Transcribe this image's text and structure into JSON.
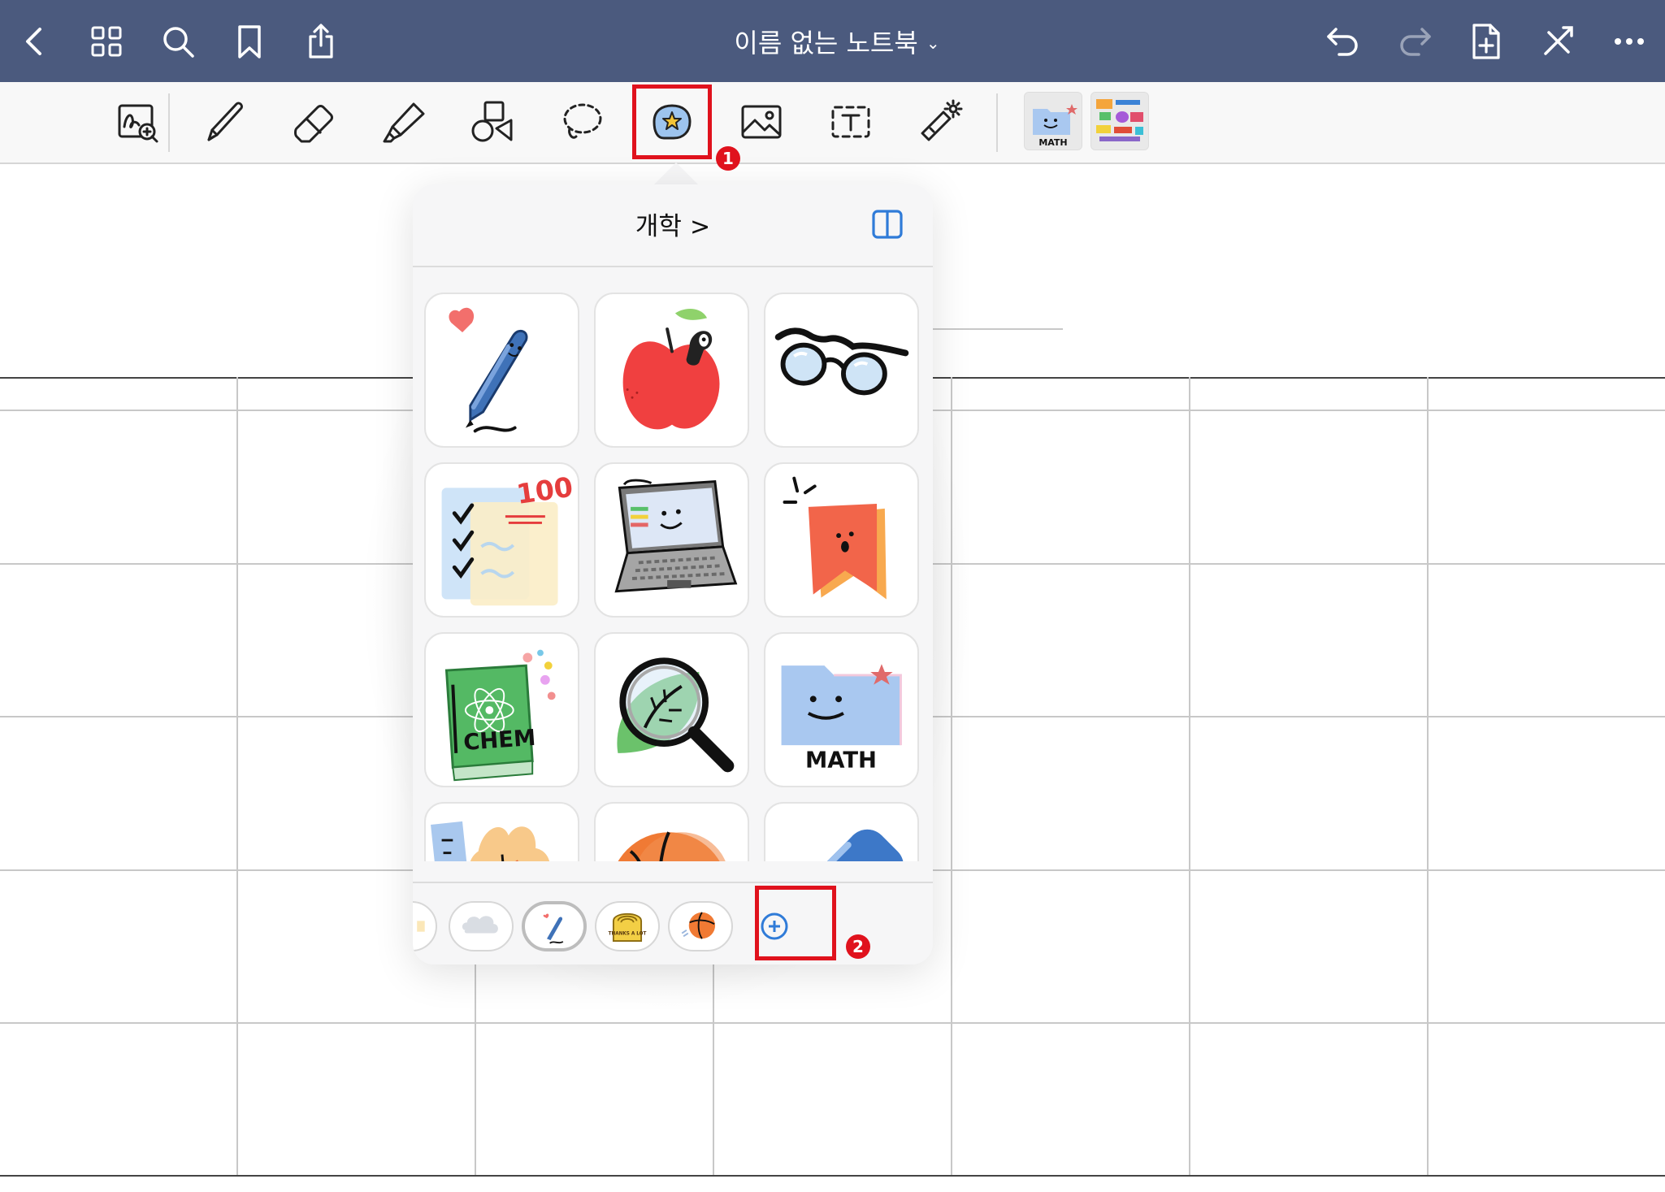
{
  "app": {
    "title": "이름 없는 노트북",
    "title_chevron": "⌄"
  },
  "nav": {
    "left": [
      "back-icon",
      "grid-view-icon",
      "search-icon",
      "bookmark-icon",
      "share-icon"
    ],
    "right": [
      "undo-icon",
      "redo-icon",
      "add-page-icon",
      "close-toolbar-icon",
      "more-icon"
    ]
  },
  "toolbar": {
    "tools": [
      "zoom-draw-icon",
      "pen-icon",
      "eraser-icon",
      "highlighter-icon",
      "shapes-icon",
      "lasso-icon",
      "sticker-icon",
      "image-icon",
      "text-icon",
      "laser-pointer-icon"
    ],
    "favorites": [
      {
        "name": "math-folder-sticker",
        "label": "MATH"
      },
      {
        "name": "colorful-stickers-thumbnail",
        "label": ""
      }
    ]
  },
  "callouts": {
    "one": "1",
    "two": "2"
  },
  "sticker_popover": {
    "pack_title": "개학",
    "pack_title_chevron": ">",
    "stickers": [
      {
        "name": "pen-heart-sticker"
      },
      {
        "name": "apple-worm-sticker"
      },
      {
        "name": "glasses-sticker"
      },
      {
        "name": "checklist-100-sticker",
        "text": "100"
      },
      {
        "name": "laptop-sticker"
      },
      {
        "name": "bookmark-surprised-sticker"
      },
      {
        "name": "chem-book-sticker",
        "text": "CHEM"
      },
      {
        "name": "magnifier-leaf-sticker"
      },
      {
        "name": "math-folder-sticker",
        "text": "MATH"
      },
      {
        "name": "ruler-leaf-sticker"
      },
      {
        "name": "basketball-sticker"
      },
      {
        "name": "eraser-sticker"
      }
    ],
    "pack_tabs": [
      {
        "name": "pack-tab-partial"
      },
      {
        "name": "pack-tab-cloud"
      },
      {
        "name": "pack-tab-back-to-school",
        "selected": true
      },
      {
        "name": "pack-tab-thanks-a-lot",
        "text": "THANKS A LOT"
      },
      {
        "name": "pack-tab-basketball"
      }
    ],
    "add_pack": "add-sticker-pack-icon"
  },
  "colors": {
    "nav_bg": "#4b5a7e",
    "highlight": "#e0121d",
    "accent_blue": "#2f7bd8"
  }
}
